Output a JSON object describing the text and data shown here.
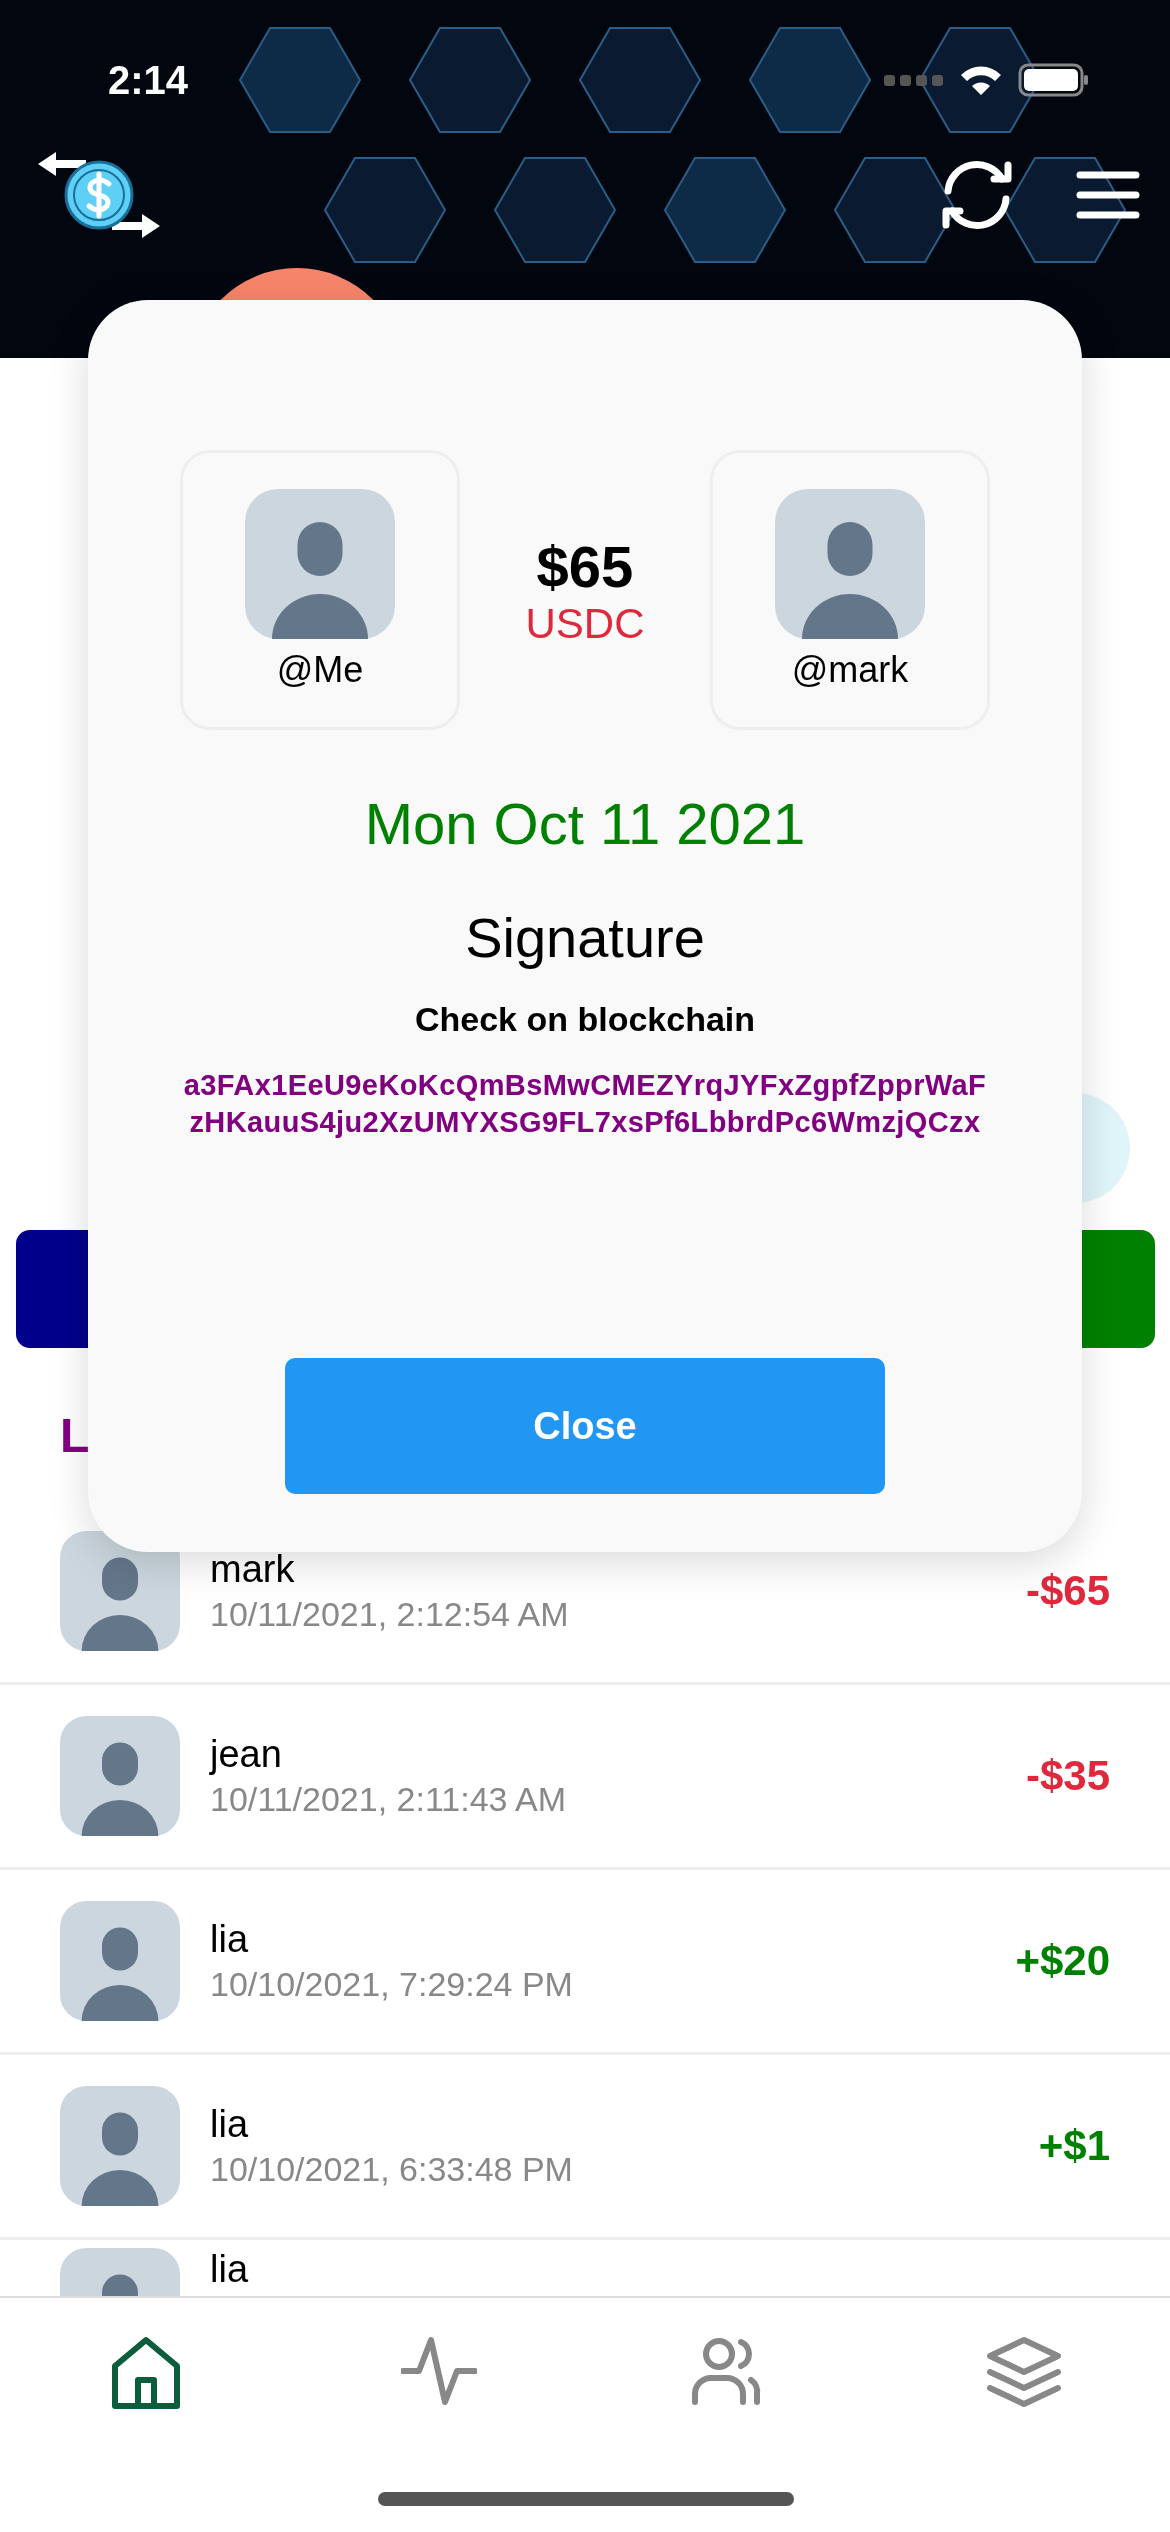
{
  "status_bar": {
    "time": "2:14"
  },
  "modal": {
    "sender": {
      "handle": "@Me"
    },
    "recipient": {
      "handle": "@mark"
    },
    "amount": "$65",
    "currency": "USDC",
    "date": "Mon Oct 11 2021",
    "title": "Signature",
    "subtitle": "Check on blockchain",
    "signature": "a3FAx1EeU9eKoKcQmBsMwCMEZYrqJYFxZgpfZpprWaFzHKauuS4ju2XzUMYXSG9FL7xsPf6LbbrdPc6WmzjQCzx",
    "close_button": "Close"
  },
  "section_heading": "L",
  "transactions": [
    {
      "name": "mark",
      "time": "10/11/2021, 2:12:54 AM",
      "amount": "-$65",
      "kind": "debit"
    },
    {
      "name": "jean",
      "time": "10/11/2021, 2:11:43 AM",
      "amount": "-$35",
      "kind": "debit"
    },
    {
      "name": "lia",
      "time": "10/10/2021, 7:29:24 PM",
      "amount": "+$20",
      "kind": "credit"
    },
    {
      "name": "lia",
      "time": "10/10/2021, 6:33:48 PM",
      "amount": "+$1",
      "kind": "credit"
    },
    {
      "name": "lia",
      "kind": "partial"
    }
  ],
  "tab_bar": [
    {
      "kind": "home",
      "selected": true
    },
    {
      "kind": "activity",
      "selected": false
    },
    {
      "kind": "people",
      "selected": false
    },
    {
      "kind": "layers",
      "selected": false
    }
  ]
}
